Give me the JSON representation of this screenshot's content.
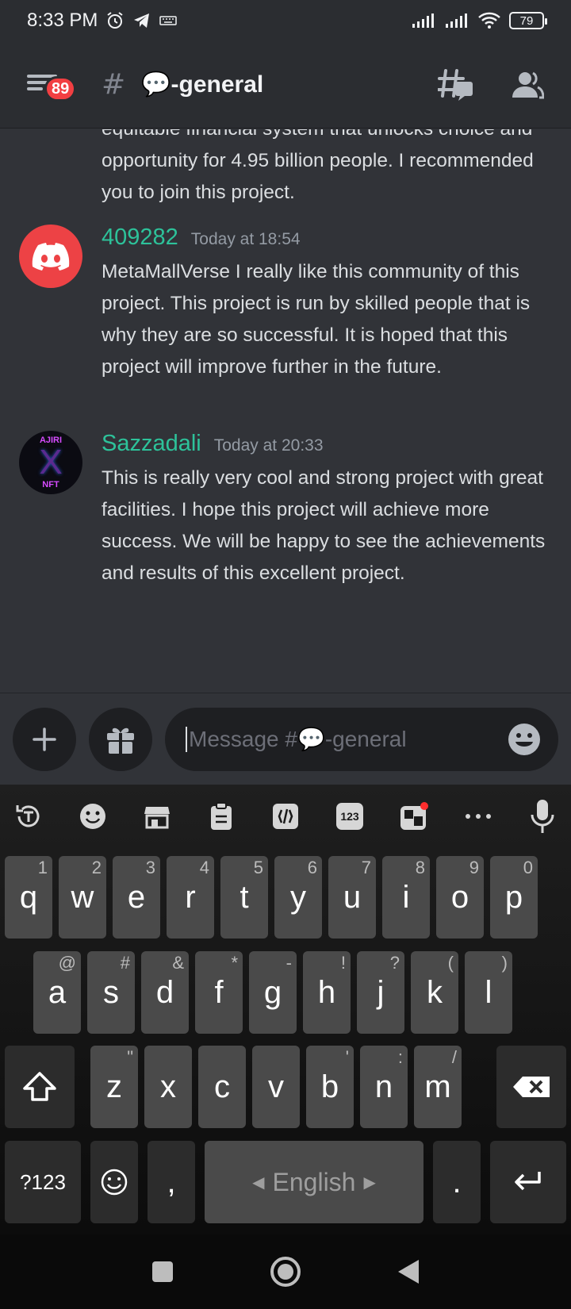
{
  "status_bar": {
    "time": "8:33 PM",
    "battery": "79"
  },
  "header": {
    "badge_count": "89",
    "hash_symbol": "#",
    "channel_name": "💬-general"
  },
  "messages": {
    "partial": {
      "text": "equitable financial system that unlocks choice and opportunity for 4.95 billion people. I recommended you to join this project."
    },
    "msg1": {
      "author": "409282",
      "timestamp": "Today at 18:54",
      "text": "MetaMallVerse I really like this community of this project. This project is run by skilled people that is why they are so successful. It is hoped that this project will improve further in the future.",
      "avatar_color": "#ed4245"
    },
    "msg2": {
      "author": "Sazzadali",
      "timestamp": "Today at 20:33",
      "text": "This is really very cool and strong project with great facilities. I hope this project will achieve more success. We will be happy to see the achievements and results of this excellent project.",
      "avatar_text_top": "AJIRI",
      "avatar_text_mid": "X",
      "avatar_text_bot": "NFT"
    }
  },
  "composer": {
    "placeholder": "Message #💬-general"
  },
  "keyboard": {
    "row1": [
      {
        "k": "q",
        "h": "1"
      },
      {
        "k": "w",
        "h": "2"
      },
      {
        "k": "e",
        "h": "3"
      },
      {
        "k": "r",
        "h": "4"
      },
      {
        "k": "t",
        "h": "5"
      },
      {
        "k": "y",
        "h": "6"
      },
      {
        "k": "u",
        "h": "7"
      },
      {
        "k": "i",
        "h": "8"
      },
      {
        "k": "o",
        "h": "9"
      },
      {
        "k": "p",
        "h": "0"
      }
    ],
    "row2": [
      {
        "k": "a",
        "h": "@"
      },
      {
        "k": "s",
        "h": "#"
      },
      {
        "k": "d",
        "h": "&"
      },
      {
        "k": "f",
        "h": "*"
      },
      {
        "k": "g",
        "h": "-"
      },
      {
        "k": "h",
        "h": "!"
      },
      {
        "k": "j",
        "h": "?"
      },
      {
        "k": "k",
        "h": "("
      },
      {
        "k": "l",
        "h": ")"
      }
    ],
    "row3": [
      {
        "k": "z",
        "h": "\""
      },
      {
        "k": "x",
        "h": ""
      },
      {
        "k": "c",
        "h": ""
      },
      {
        "k": "v",
        "h": ""
      },
      {
        "k": "b",
        "h": "'"
      },
      {
        "k": "n",
        "h": ":"
      },
      {
        "k": "m",
        "h": "/"
      }
    ],
    "symbols_label": "?123",
    "comma": ",",
    "period": ".",
    "space_label": "English",
    "toolbar_number_icon": "123"
  }
}
